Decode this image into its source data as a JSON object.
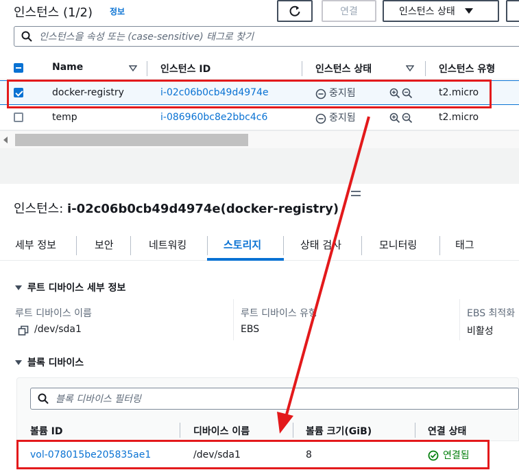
{
  "header": {
    "title": "인스턴스 (1/2)",
    "info_link": "정보",
    "connect_label": "연결",
    "state_dropdown_label": "인스턴스 상태",
    "search_placeholder": "인스턴스을 속성 또는 (case-sensitive) 태그로 찾기"
  },
  "table": {
    "columns": [
      "Name",
      "인스턴스 ID",
      "인스턴스 상태",
      "인스턴스 유형"
    ],
    "rows": [
      {
        "name": "docker-registry",
        "id": "i-02c06b0cb49d4974e",
        "state": "중지됨",
        "type": "t2.micro",
        "selected": true
      },
      {
        "name": "temp",
        "id": "i-086960bc8e2bbc4c6",
        "state": "중지됨",
        "type": "t2.micro",
        "selected": false
      }
    ]
  },
  "detail": {
    "title_prefix": "인스턴스: ",
    "title_main": "i-02c06b0cb49d4974e(docker-registry)",
    "tabs": [
      "세부 정보",
      "보안",
      "네트워킹",
      "스토리지",
      "상태 검사",
      "모니터링",
      "태그"
    ],
    "active_tab": "스토리지",
    "root_section": {
      "heading": "루트 디바이스 세부 정보",
      "device_name_label": "루트 디바이스 이름",
      "device_name_value": "/dev/sda1",
      "device_type_label": "루트 디바이스 유형",
      "device_type_value": "EBS",
      "ebs_opt_label": "EBS 최적화",
      "ebs_opt_value": "비활성"
    },
    "block_section": {
      "heading": "블록 디바이스",
      "filter_placeholder": "블록 디바이스 필터링",
      "columns": [
        "볼륨 ID",
        "디바이스 이름",
        "볼륨 크기(GiB)",
        "연결 상태"
      ],
      "rows": [
        {
          "volume_id": "vol-078015be205835ae1",
          "device_name": "/dev/sda1",
          "size": "8",
          "status": "연결됨"
        }
      ]
    }
  },
  "colors": {
    "link": "#0972d3",
    "annotation_red": "#e3191b",
    "success_green": "#037f0c"
  }
}
